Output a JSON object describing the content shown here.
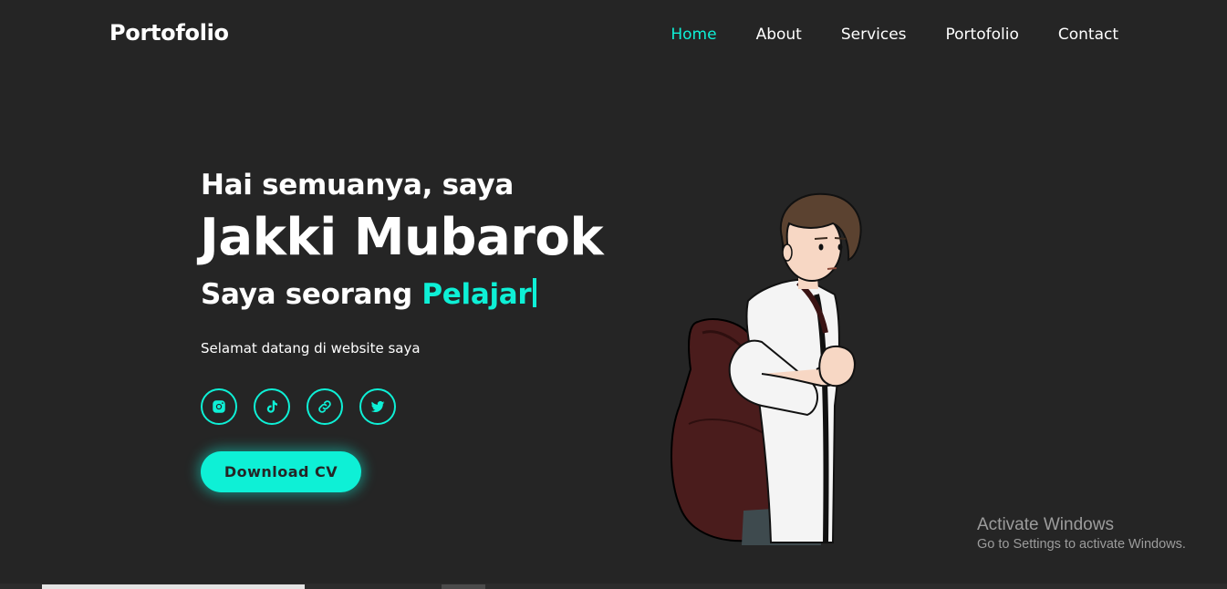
{
  "header": {
    "logo": "Portofolio",
    "nav": [
      {
        "label": "Home",
        "active": true
      },
      {
        "label": "About",
        "active": false
      },
      {
        "label": "Services",
        "active": false
      },
      {
        "label": "Portofolio",
        "active": false
      },
      {
        "label": "Contact",
        "active": false
      }
    ]
  },
  "hero": {
    "greeting": "Hai semuanya, saya",
    "name": "Jakki Mubarok",
    "role_prefix": "Saya seorang",
    "role_highlight": "Pelajar",
    "welcome": "Selamat datang di website saya",
    "socials": [
      {
        "icon": "instagram-icon"
      },
      {
        "icon": "tiktok-icon"
      },
      {
        "icon": "link-icon"
      },
      {
        "icon": "twitter-icon"
      }
    ],
    "download_label": "Download CV"
  },
  "watermark": {
    "title": "Activate Windows",
    "subtitle": "Go to Settings to activate Windows."
  },
  "colors": {
    "background": "#252525",
    "accent": "#0ef0d6",
    "text": "#ffffff"
  }
}
